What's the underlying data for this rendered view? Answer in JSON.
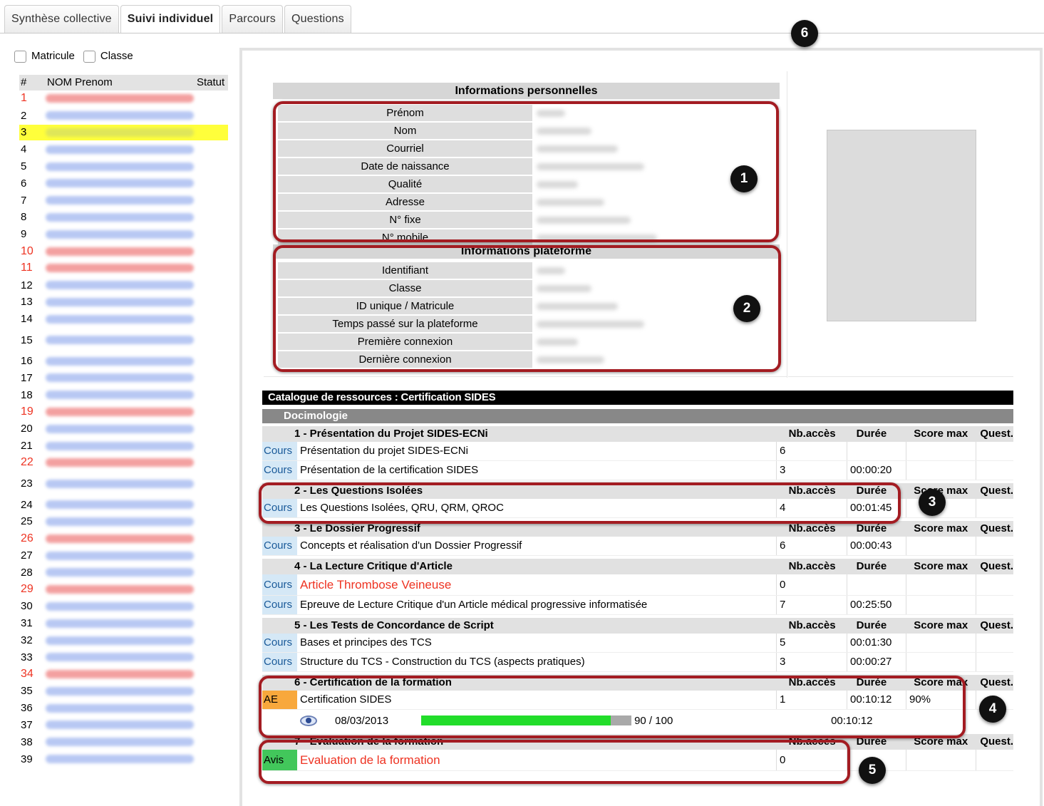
{
  "tabs": [
    {
      "label": "Synthèse collective",
      "active": false
    },
    {
      "label": "Suivi individuel",
      "active": true
    },
    {
      "label": "Parcours",
      "active": false
    },
    {
      "label": "Questions",
      "active": false
    }
  ],
  "filters": {
    "matricule": "Matricule",
    "classe": "Classe"
  },
  "list": {
    "headers": {
      "num": "#",
      "name": "NOM Prenom",
      "status": "Statut"
    },
    "rows": [
      {
        "num": "1",
        "red": true
      },
      {
        "num": "2"
      },
      {
        "num": "3",
        "selected": true
      },
      {
        "num": "4"
      },
      {
        "num": "5"
      },
      {
        "num": "6"
      },
      {
        "num": "7"
      },
      {
        "num": "8"
      },
      {
        "num": "9"
      },
      {
        "num": "10",
        "red": true
      },
      {
        "num": "11",
        "red": true
      },
      {
        "num": "12"
      },
      {
        "num": "13"
      },
      {
        "num": "14"
      },
      {
        "num": "15",
        "tall": true
      },
      {
        "num": "16"
      },
      {
        "num": "17"
      },
      {
        "num": "18"
      },
      {
        "num": "19",
        "red": true
      },
      {
        "num": "20"
      },
      {
        "num": "21"
      },
      {
        "num": "22",
        "red": true
      },
      {
        "num": "23",
        "tall": true
      },
      {
        "num": "24"
      },
      {
        "num": "25"
      },
      {
        "num": "26",
        "red": true
      },
      {
        "num": "27"
      },
      {
        "num": "28"
      },
      {
        "num": "29",
        "red": true
      },
      {
        "num": "30"
      },
      {
        "num": "31"
      },
      {
        "num": "32"
      },
      {
        "num": "33"
      },
      {
        "num": "34",
        "red": true
      },
      {
        "num": "35"
      },
      {
        "num": "36"
      },
      {
        "num": "37"
      },
      {
        "num": "38"
      },
      {
        "num": "39"
      }
    ]
  },
  "personal": {
    "title": "Informations personnelles",
    "fields": [
      "Prénom",
      "Nom",
      "Courriel",
      "Date de naissance",
      "Qualité",
      "Adresse",
      "N° fixe",
      "N° mobile"
    ]
  },
  "platform": {
    "title": "Informations plateforme",
    "fields": [
      "Identifiant",
      "Classe",
      "ID unique / Matricule",
      "Temps passé sur la plateforme",
      "Première connexion",
      "Dernière connexion"
    ]
  },
  "badges": [
    "1",
    "2",
    "3",
    "4",
    "5",
    "6"
  ],
  "catalogue": {
    "title": "Catalogue de ressources : Certification SIDES",
    "category": "Docimologie",
    "col_headers": {
      "nb": "Nb.accès",
      "duree": "Durée",
      "score": "Score max",
      "quest": "Quest."
    },
    "modules": [
      {
        "title": "1 - Présentation du Projet SIDES-ECNi",
        "items": [
          {
            "type": "Cours",
            "title": "Présentation du projet SIDES-ECNi",
            "nb": "6",
            "duree": "",
            "score": ""
          },
          {
            "type": "Cours",
            "title": "Présentation de la certification SIDES",
            "nb": "3",
            "duree": "00:00:20",
            "score": ""
          }
        ]
      },
      {
        "title": "2 - Les Questions Isolées",
        "items": [
          {
            "type": "Cours",
            "title": "Les Questions Isolées, QRU, QRM, QROC",
            "nb": "4",
            "duree": "00:01:45",
            "score": ""
          }
        ]
      },
      {
        "title": "3 - Le Dossier Progressif",
        "items": [
          {
            "type": "Cours",
            "title": "Concepts et réalisation d'un Dossier Progressif",
            "nb": "6",
            "duree": "00:00:43",
            "score": ""
          }
        ]
      },
      {
        "title": "4 - La Lecture Critique d'Article",
        "items": [
          {
            "type": "Cours",
            "title": "Article Thrombose Veineuse",
            "nb": "0",
            "duree": "",
            "score": "",
            "red": true
          },
          {
            "type": "Cours",
            "title": "Epreuve de Lecture Critique d'un Article médical progressive informatisée",
            "nb": "7",
            "duree": "00:25:50",
            "score": ""
          }
        ]
      },
      {
        "title": "5 - Les Tests de Concordance de Script",
        "items": [
          {
            "type": "Cours",
            "title": "Bases et principes des TCS",
            "nb": "5",
            "duree": "00:01:30",
            "score": ""
          },
          {
            "type": "Cours",
            "title": "Structure du TCS - Construction du TCS (aspects pratiques)",
            "nb": "3",
            "duree": "00:00:27",
            "score": ""
          }
        ]
      },
      {
        "title": "6 - Certification de la formation",
        "items": [
          {
            "type": "AE",
            "title": "Certification SIDES",
            "nb": "1",
            "duree": "00:10:12",
            "score": "90%"
          }
        ],
        "attempt": {
          "date": "08/03/2013",
          "progress": 0.9,
          "score": "90 / 100",
          "duree": "00:10:12"
        }
      },
      {
        "title": "7 - Evaluation de la formation",
        "items": [
          {
            "type": "Avis",
            "title": "Evaluation de la formation",
            "nb": "0",
            "duree": "",
            "score": "",
            "red": true
          }
        ]
      }
    ]
  }
}
